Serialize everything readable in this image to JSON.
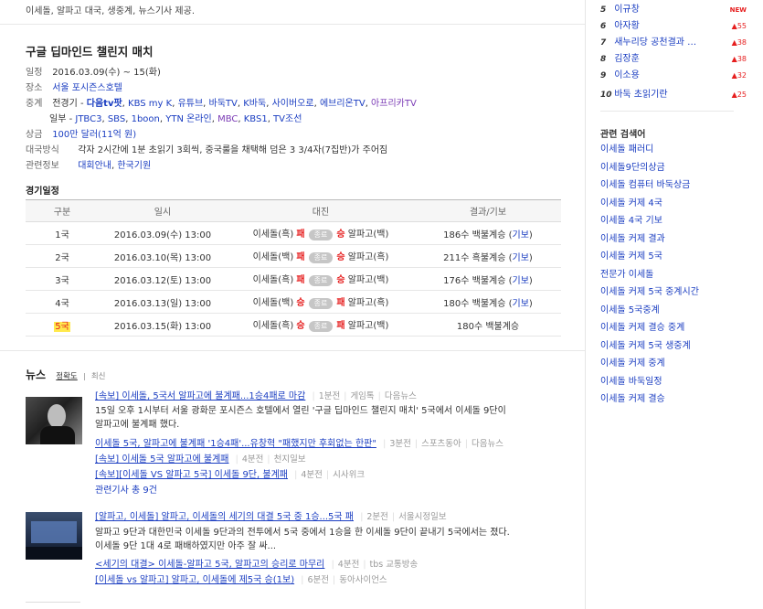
{
  "top_text": "이세돌, 알파고 대국, 생중계, 뉴스기사 제공.",
  "event": {
    "title": "구글 딥마인드 챌린지 매치",
    "schedule_label": "일정",
    "schedule_value": "2016.03.09(수) ~ 15(화)",
    "place_label": "장소",
    "place_value": "서울 포시즌스호텔",
    "broadcast_label": "중계",
    "full_label": "전경기 -",
    "full_channels": [
      "다음tv팟",
      "KBS my K",
      "유튜브",
      "바둑TV",
      "K바둑",
      "사이버오로",
      "에브리온TV",
      "아프리카TV"
    ],
    "partial_label": "일부 -",
    "partial_channels": [
      "JTBC3",
      "SBS",
      "1boon",
      "YTN 온라인",
      "MBC",
      "KBS1",
      "TV조선"
    ],
    "prize_label": "상금",
    "prize_value": "100만 달러(11억 원)",
    "format_label": "대국방식",
    "format_value": "각자 2시간에 1분 초읽기 3회씩, 중국룰을 채택해 덤은 3 3/4자(7집반)가 주어짐",
    "related_label": "관련정보",
    "related_links": [
      "대회안내",
      "한국기원"
    ]
  },
  "schedule_table": {
    "title": "경기일정",
    "headers": [
      "구분",
      "일시",
      "대진",
      "결과/기보"
    ],
    "rows": [
      {
        "round": "1국",
        "date": "2016.03.09(수) 13:00",
        "p1": "이세돌(흑)",
        "r1": "패",
        "status": "종료",
        "r2": "승",
        "p2": "알파고(백)",
        "result": "186수 백불계승",
        "kibo": "기보"
      },
      {
        "round": "2국",
        "date": "2016.03.10(목) 13:00",
        "p1": "이세돌(백)",
        "r1": "패",
        "status": "종료",
        "r2": "승",
        "p2": "알파고(흑)",
        "result": "211수 흑불계승",
        "kibo": "기보"
      },
      {
        "round": "3국",
        "date": "2016.03.12(토) 13:00",
        "p1": "이세돌(흑)",
        "r1": "패",
        "status": "종료",
        "r2": "승",
        "p2": "알파고(백)",
        "result": "176수 백불계승",
        "kibo": "기보"
      },
      {
        "round": "4국",
        "date": "2016.03.13(일) 13:00",
        "p1": "이세돌(백)",
        "r1": "승",
        "status": "종료",
        "r2": "패",
        "p2": "알파고(흑)",
        "result": "180수 백불계승",
        "kibo": "기보"
      },
      {
        "round": "5국",
        "date": "2016.03.15(화) 13:00",
        "p1": "이세돌(흑)",
        "r1": "승",
        "status": "종료",
        "r2": "패",
        "p2": "알파고(백)",
        "result": "180수 백불계승",
        "kibo": ""
      }
    ]
  },
  "news": {
    "title": "뉴스",
    "sort_accuracy": "정확도",
    "sort_latest": "최신",
    "item1": {
      "title": "[속보] 이세돌, 5국서 알파고에 불계패...1승4패로 마감",
      "time": "1분전",
      "source": "게임톡",
      "portal": "다음뉴스",
      "desc1": "15일 오후 1시부터 서울 광화문 포시즌스 호텔에서 열린 '구글 딥마인드 챌린지 매치' 5국에서 이세돌 9단이",
      "desc2": "알파고에 불계패 했다.",
      "sub1_title": "이세돌 5국, 알파고에 불계패 '1승4패'...유창혁 \"패했지만 후회없는 한판\"",
      "sub1_time": "3분전",
      "sub1_source": "스포츠동아",
      "sub1_portal": "다음뉴스",
      "sub2_title": "[속보] 이세돌 5국 알파고에 불계패",
      "sub2_time": "4분전",
      "sub2_source": "천지일보",
      "sub3_title": "[속보][이세돌 VS 알파고 5국] 이세돌 9단, 불계패",
      "sub3_time": "4분전",
      "sub3_source": "시사위크",
      "related": "관련기사 총 9건"
    },
    "item2": {
      "title": "[알파고, 이세돌] 알파고, 이세돌의 세기의 대결 5국 중 1승...5국 패",
      "time": "2분전",
      "source": "서울시정일보",
      "desc1": "알파고 9단과 대한민국 이세돌 9단과의 전투에서 5국 중에서 1승을 한 이세돌 9단이 끝내기 5국에서는 졌다.",
      "desc2": "이세돌 9단 1대 4로 패배하였지만 아주 잘 싸...",
      "sub1_title": "<세기의 대결> 이세돌-알파고 5국, 알파고의 승리로 마무리",
      "sub1_time": "4분전",
      "sub1_source": "tbs 교통방송",
      "sub2_title": "[이세돌 vs 알파고] 알파고, 이세돌에 제5국 승(1보)",
      "sub2_time": "6분전",
      "sub2_source": "동아사이언스"
    }
  },
  "ranking": [
    {
      "num": "5",
      "name": "이규창",
      "change": "NEW"
    },
    {
      "num": "6",
      "name": "아자황",
      "change": "55"
    },
    {
      "num": "7",
      "name": "새누리당 공천결과 …",
      "change": "38"
    },
    {
      "num": "8",
      "name": "김장훈",
      "change": "38"
    },
    {
      "num": "9",
      "name": "이소용",
      "change": "32"
    },
    {
      "num": "10",
      "name": "바둑 초읽기란",
      "change": "25"
    }
  ],
  "related_search": {
    "title": "관련 검색어",
    "items": [
      "이세돌 패러디",
      "이세돌9단의상금",
      "이세돌 컴퓨터 바둑상금",
      "이세돌 커제 4국",
      "이세돌 4국 기보",
      "이세돌 커제 결과",
      "이세돌 커제 5국",
      "전문가 이세돌",
      "이세돌 커제 5국 중계시간",
      "이세돌 5국중계",
      "이세돌 커제 결승 중계",
      "이세돌 커제 5국 생중계",
      "이세돌 커제 중계",
      "이세돌 바둑일정",
      "이세돌 커제 결승"
    ]
  },
  "colors": {
    "link": "#1a3dc1",
    "win_loss": "#e61e1e",
    "highlight": "#ffe94d"
  }
}
